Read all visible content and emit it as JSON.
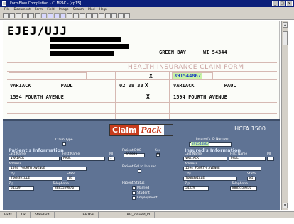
{
  "window": {
    "title": "FormFlow Completion - CLMPAK - [cp15]",
    "buttons": [
      "_",
      "□",
      "×"
    ]
  },
  "menu": [
    "File",
    "Document",
    "Form",
    "Field",
    "Image",
    "Search",
    "Mod",
    "Help"
  ],
  "form": {
    "ocr_number": "EJEJ/UJJ",
    "city": "GREEN BAY",
    "state_zip": "WI 54344",
    "title": "HEALTH INSURANCE CLAIM FORM",
    "insured_id": "391544867",
    "patient_name": "VARIACK          PAUL",
    "birth_date": "02 08 33",
    "insured_name": "VARIACK          PAUL",
    "patient_address": "1594 FOURTH AVENUE",
    "insured_address": "1594 FOURTH AVENUE",
    "sex_mark": "X",
    "relation_mark": "X"
  },
  "panel": {
    "brand_a": "Claim",
    "brand_b": "Pack",
    "form_code": "HCFA 1500",
    "claim_type_label": "Claim Type",
    "insured_id_label": "Insured's ID Number",
    "insured_id_value": "391544867",
    "patient_section": "Patient's Information",
    "insured_section": "Insured's Information",
    "last_name_label": "Last Name",
    "first_name_label": "First Name",
    "mi_label": "MI",
    "patient_last": "VARIACK",
    "patient_first": "PAUL",
    "patient_mi": "I",
    "address_label": "Address",
    "patient_address": "1594 FOURTH AVENUE",
    "city_label": "City",
    "state_label": "State",
    "patient_city": "TOWNSVILLE",
    "patient_state": "WI",
    "zip_label": "Zip",
    "telephone_label": "Telephone",
    "patient_zip": "54329",
    "patient_phone": "8885559876",
    "dob_label": "Patient DOB",
    "sex_label": "Sex",
    "dob_value": "020833",
    "sex_value": "M",
    "rel_label": "Patient Rel to Insured",
    "status_label": "Patient Status",
    "status_options": [
      "Married",
      "Student",
      "Employment"
    ],
    "insured_last": "VARIACK",
    "insured_first": "PAUL",
    "insured_address": "1594 FOURTH AVENUE",
    "insured_city": "TOWNSVILLE",
    "insured_state": "WI",
    "insured_zip": "54329",
    "insured_phone": "8885559876"
  },
  "status": [
    "Exits",
    "Ok",
    "Standard",
    "HR169",
    "PTs_insured_Id"
  ]
}
